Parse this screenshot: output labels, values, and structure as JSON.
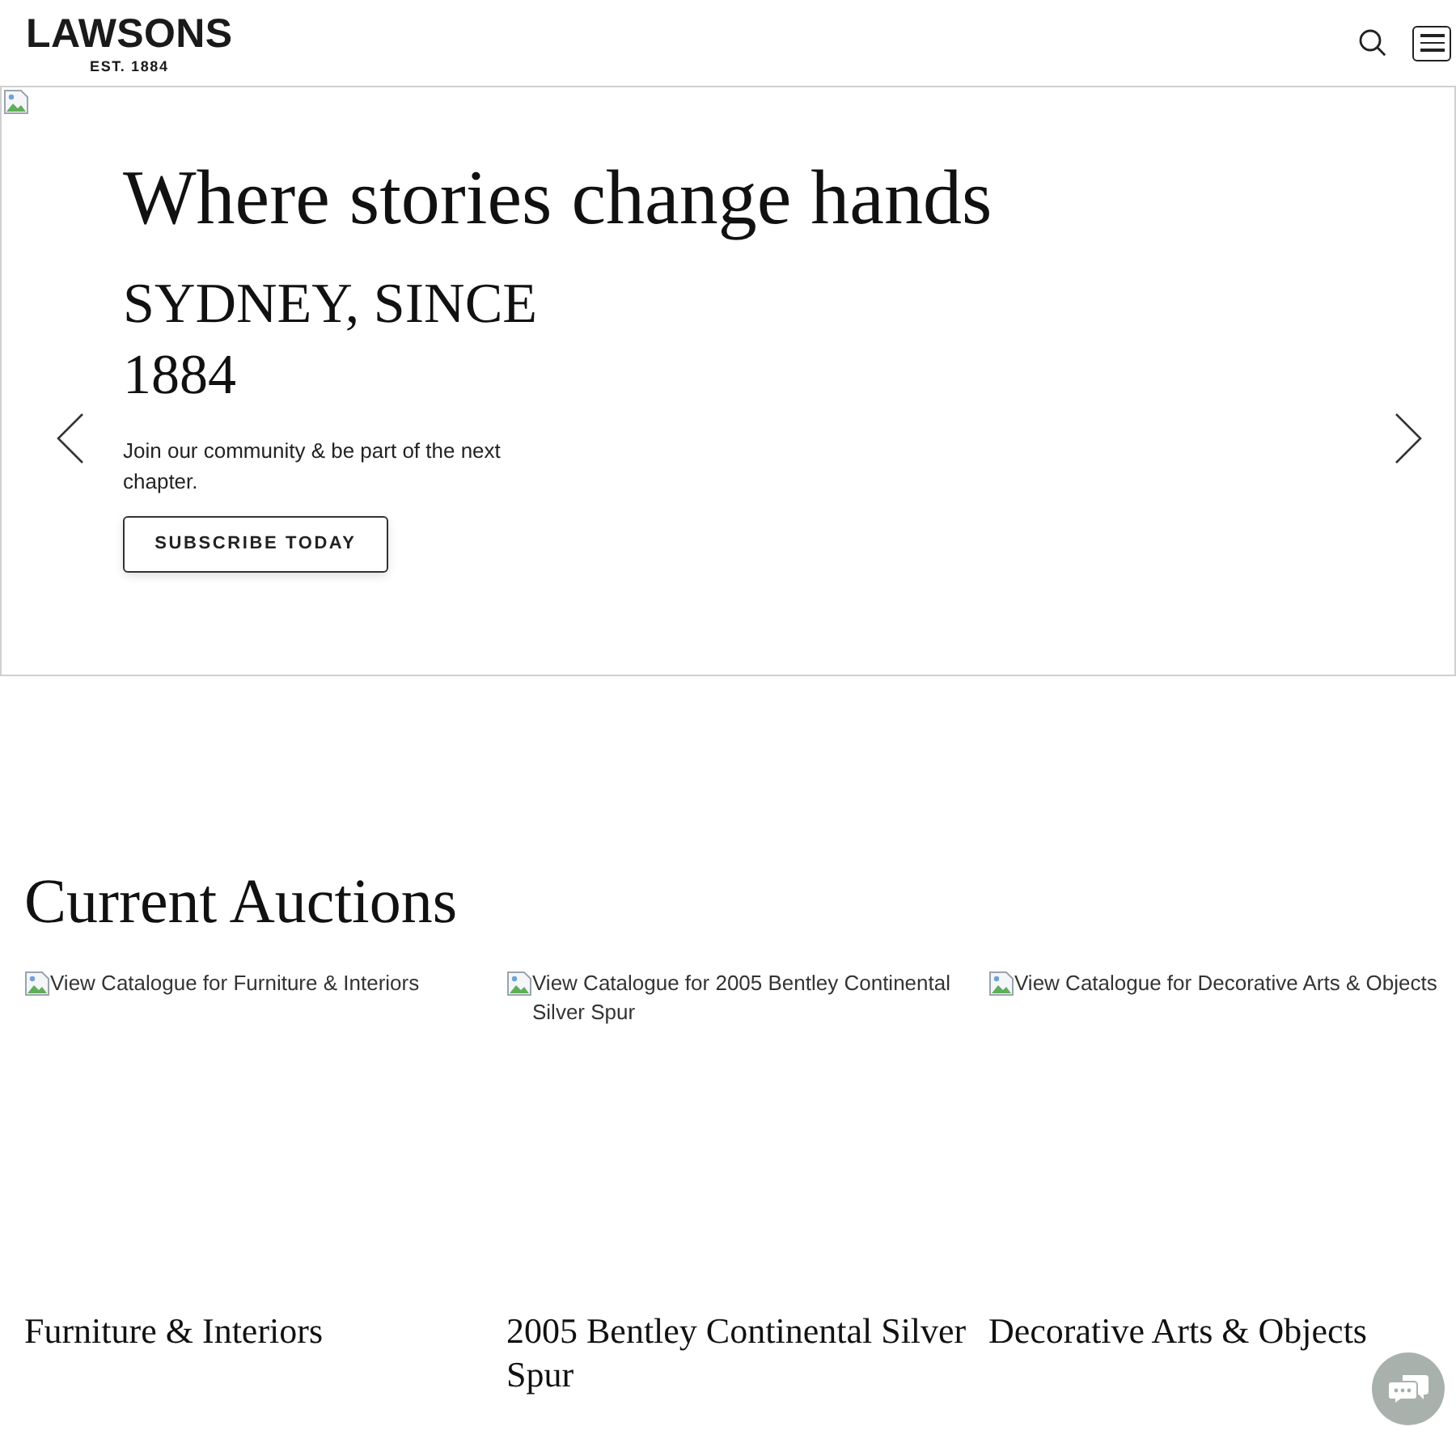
{
  "header": {
    "logo": {
      "name": "LAWSONS",
      "tagline": "EST. 1884"
    }
  },
  "hero": {
    "title": "Where stories change hands",
    "subtitle": "SYDNEY, SINCE 1884",
    "text": "Join our community & be part of the next chapter.",
    "button": "SUBSCRIBE TODAY"
  },
  "auctions": {
    "heading": "Current Auctions",
    "items": [
      {
        "image_alt": "View Catalogue for Furniture & Interiors",
        "title": "Furniture & Interiors"
      },
      {
        "image_alt": "View Catalogue for 2005 Bentley Continental Silver Spur",
        "title": "2005 Bentley Continental Silver Spur"
      },
      {
        "image_alt": "View Catalogue for Decorative Arts & Objects",
        "title": "Decorative Arts & Objects"
      }
    ]
  }
}
